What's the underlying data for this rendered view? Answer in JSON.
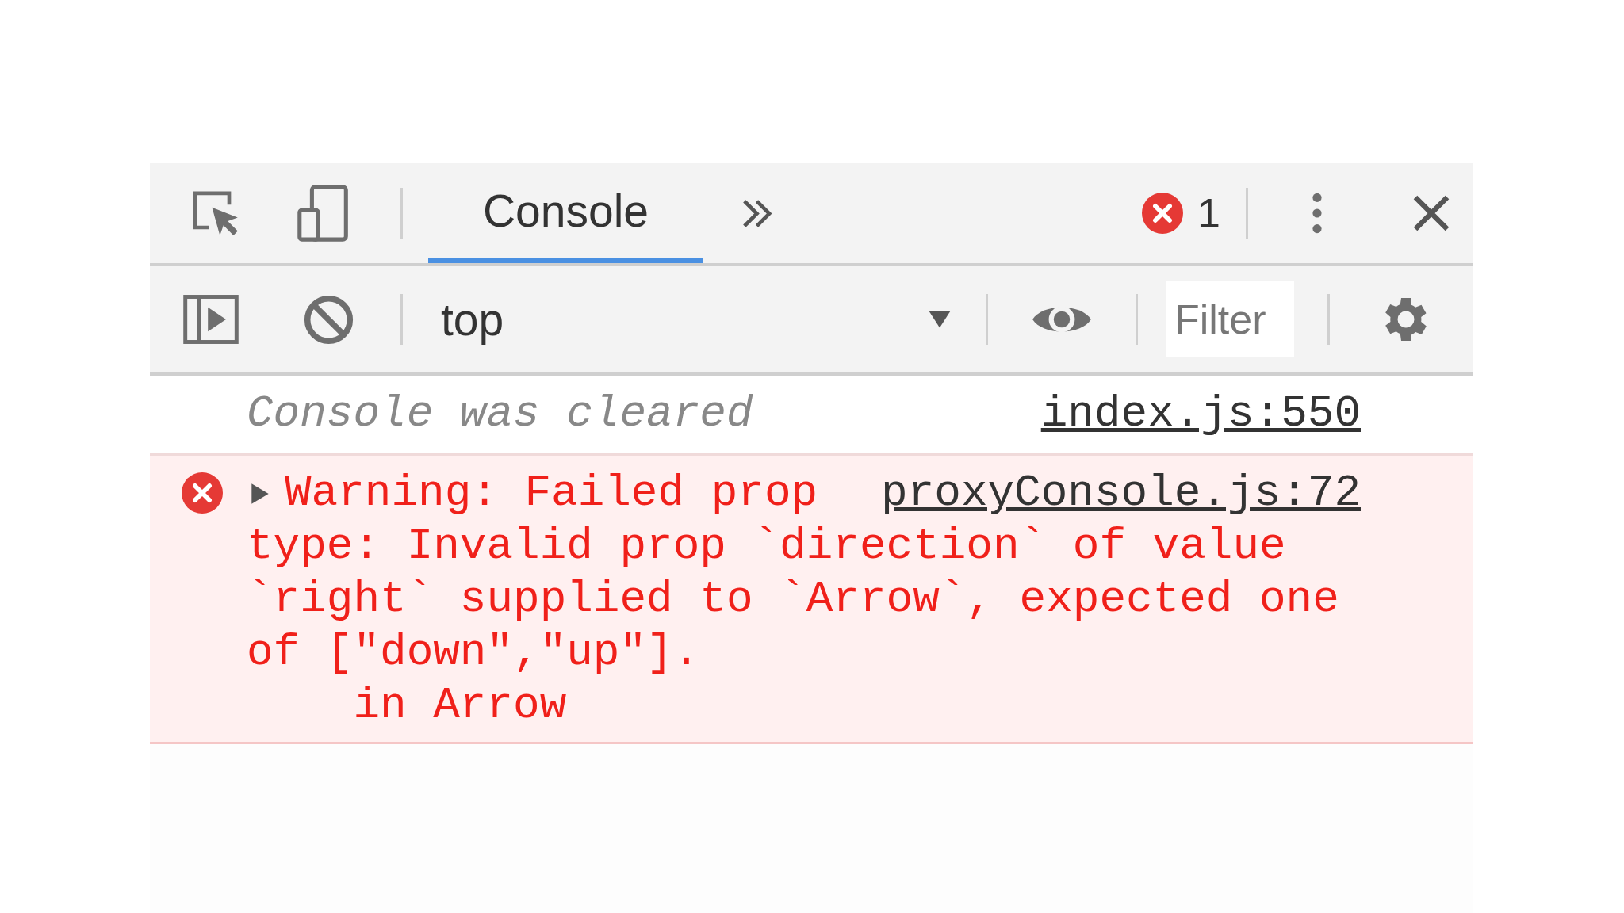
{
  "main_toolbar": {
    "tabs": [
      {
        "label": "Console",
        "selected": true
      }
    ],
    "error_count": "1"
  },
  "console_toolbar": {
    "context": "top",
    "filter": {
      "placeholder": "Filter"
    }
  },
  "messages": [
    {
      "kind": "info",
      "text": "Console was cleared",
      "source": "index.js:550"
    },
    {
      "kind": "error",
      "expanded": false,
      "lines": [
        "Warning: Failed prop",
        "type: Invalid prop `direction` of value",
        "`right` supplied to `Arrow`, expected one",
        "of [\"down\",\"up\"].",
        "    in Arrow"
      ],
      "source": "proxyConsole.js:72"
    }
  ]
}
